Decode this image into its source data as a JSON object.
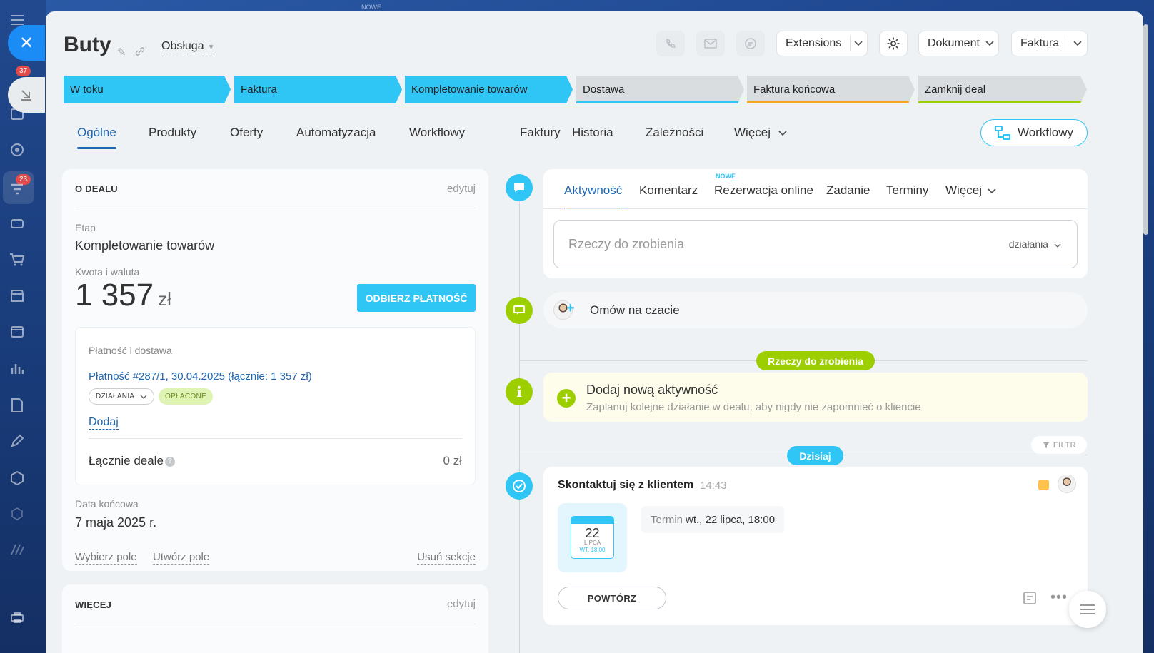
{
  "top_badge": "NOWE",
  "leftbar": {
    "badge1": "37",
    "badge2": "23"
  },
  "header": {
    "title": "Buty",
    "category": "Obsługa",
    "extensions": "Extensions",
    "dokument": "Dokument",
    "faktura": "Faktura"
  },
  "stages": [
    {
      "label": "W toku",
      "state": "active",
      "color": "#2fc6f6"
    },
    {
      "label": "Faktura",
      "state": "active",
      "color": "#2fc6f6"
    },
    {
      "label": "Kompletowanie towarów",
      "state": "active",
      "color": "#2fc6f6"
    },
    {
      "label": "Dostawa",
      "state": "inactive",
      "color": "#2fc6f6"
    },
    {
      "label": "Faktura końcowa",
      "state": "inactive",
      "color": "#f5a623"
    },
    {
      "label": "Zamknij deal",
      "state": "inactive",
      "color": "#9dcf00"
    }
  ],
  "tabs": [
    "Ogólne",
    "Produkty",
    "Oferty",
    "Automatyzacja",
    "Workflowy",
    "Faktury",
    "Historia",
    "Zależności",
    "Więcej"
  ],
  "workflow_button": "Workflowy",
  "about": {
    "title": "O DEALU",
    "edit": "edytuj",
    "stage_label": "Etap",
    "stage_value": "Kompletowanie towarów",
    "amount_label": "Kwota i waluta",
    "amount": "1 357",
    "currency": "zł",
    "pay_button": "ODBIERZ PŁATNOŚĆ",
    "payment": {
      "title": "Płatność i dostawa",
      "link": "Płatność #287/1, 30.04.2025 (łącznie: 1 357 zł)",
      "actions": "DZIAŁANIA",
      "status": "OPŁACONE",
      "add": "Dodaj",
      "total_label": "Łącznie deale",
      "total_value": "0 zł"
    },
    "end_date_label": "Data końcowa",
    "end_date": "7 maja 2025 r.",
    "select_field": "Wybierz pole",
    "create_field": "Utwórz pole",
    "delete_section": "Usuń sekcje"
  },
  "more_card": {
    "title": "WIĘCEJ",
    "edit": "edytuj"
  },
  "activity": {
    "tabs": [
      "Aktywność",
      "Komentarz",
      "Rezerwacja online",
      "Zadanie",
      "Terminy",
      "Więcej"
    ],
    "new_badge": "NOWE",
    "todo_placeholder": "Rzeczy do zrobienia",
    "todo_actions": "działania",
    "chat": "Omów na czacie",
    "todo_divider": "Rzeczy do zrobienia",
    "add_title": "Dodaj nową aktywność",
    "add_subtitle": "Zaplanuj kolejne działanie w dealu, aby nigdy nie zapomnieć o kliencie",
    "today": "Dzisiaj",
    "filter": "FILTR",
    "item": {
      "title": "Skontaktuj się z klientem",
      "time": "14:43",
      "cal_day": "22",
      "cal_month": "LIPCA",
      "cal_week": "WT. 18:00",
      "termin_label": "Termin",
      "termin_value": "wt., 22 lipca, 18:00",
      "repeat": "POWTÓRZ"
    }
  }
}
